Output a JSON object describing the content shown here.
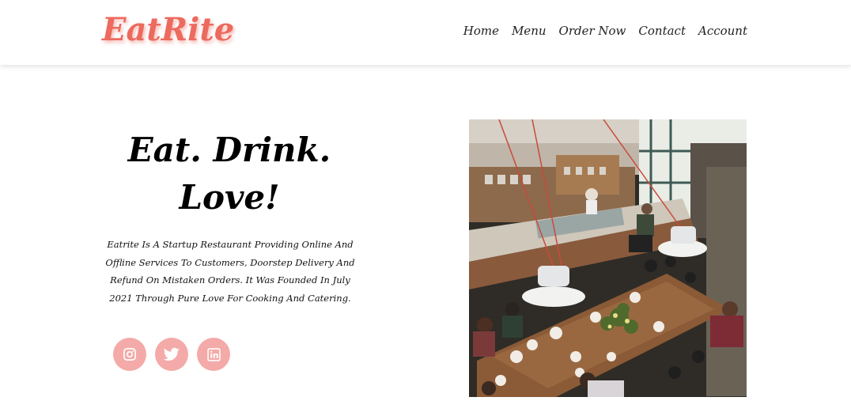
{
  "brand": {
    "name": "EatRite",
    "color": "#ec6a5e"
  },
  "nav": {
    "items": [
      {
        "label": "Home"
      },
      {
        "label": "Menu"
      },
      {
        "label": "Order Now"
      },
      {
        "label": "Contact"
      },
      {
        "label": "Account"
      }
    ]
  },
  "hero": {
    "headline_line1": "Eat. Drink.",
    "headline_line2": "Love!",
    "description": "Eatrite Is A Startup Restaurant Providing Online And Offline Services To Customers, Doorstep Delivery And Refund On Mistaken Orders. It Was Founded In July 2021 Through Pure Love For Cooking And Catering."
  },
  "socials": [
    {
      "icon": "instagram-icon"
    },
    {
      "icon": "twitter-icon"
    },
    {
      "icon": "linkedin-icon"
    }
  ],
  "colors": {
    "social_bg": "#f4aaa8",
    "accent": "#ec6a5e"
  }
}
